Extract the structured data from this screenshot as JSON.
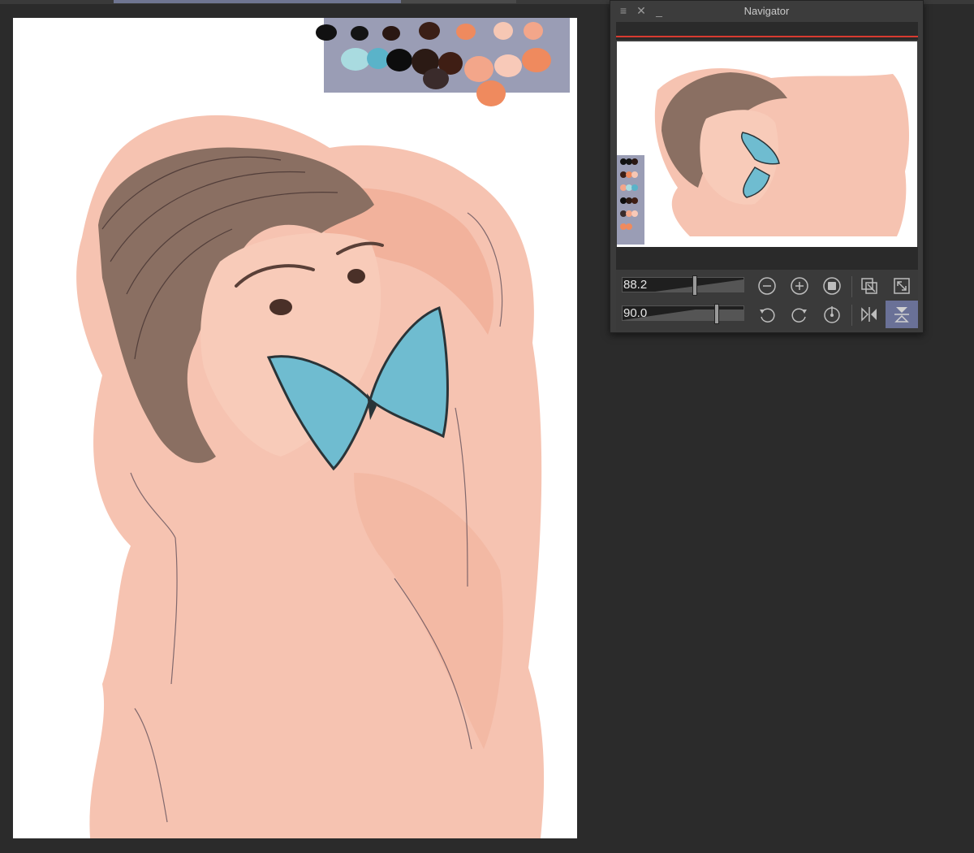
{
  "navigator": {
    "title": "Navigator",
    "zoom_value": "88.2",
    "rotation_value": "90.0",
    "zoom_slider_level": 0.6,
    "rotation_slider_level": 0.78,
    "icons": {
      "menu": "menu-icon",
      "close": "close-icon",
      "minimize": "minimize-icon",
      "zoom_out": "zoom-out-icon",
      "zoom_in": "zoom-in-icon",
      "actual_size": "actual-size-icon",
      "fit_window": "fit-window-icon",
      "fit_navigator": "fit-navigator-icon",
      "rotate_left": "rotate-left-icon",
      "rotate_right": "rotate-right-icon",
      "reset_rotation": "reset-rotation-icon",
      "flip_horizontal": "flip-horizontal-icon",
      "flip_vertical": "flip-vertical-icon"
    }
  },
  "palette": {
    "background": "#9a9db5",
    "swatches": [
      "#111111",
      "#141414",
      "#2a1712",
      "#3b1f16",
      "#ef8a5e",
      "#f6c7b4",
      "#f3a68a",
      "#a9dbe0",
      "#5ab3c9",
      "#0d0d0d",
      "#2b1a14",
      "#3f1e14",
      "#3a2b2b",
      "#f3a68a",
      "#f8c9b8",
      "#ef8a5e",
      "#ef8a5e"
    ]
  },
  "colors": {
    "skin": "#f6c3b1",
    "skin_shadow": "#efa48a",
    "hair": "#8a6f62",
    "butterfly": "#6fbcd0",
    "accent": "#6a7197",
    "redline": "#d83a30"
  }
}
